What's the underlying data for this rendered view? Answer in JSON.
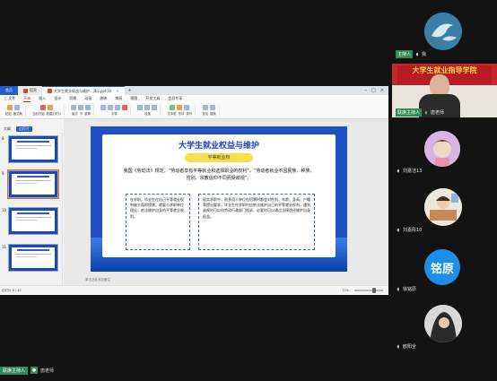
{
  "app": {
    "tabs": [
      {
        "label": "首页"
      },
      {
        "label": "稻壳"
      },
      {
        "label": "大学生就业权益与维护...演示ppt(1)"
      }
    ],
    "menu": [
      "三 文件",
      "开始",
      "插入",
      "设计",
      "切换",
      "动画",
      "放映",
      "审阅",
      "视图",
      "开发工具",
      "会员专享"
    ],
    "ribbon": [
      "粘贴",
      "格式刷",
      "当前开始",
      "新建幻灯片",
      "版式",
      "节",
      "重置",
      "字体",
      "段落",
      "文本框",
      "形状",
      "排列",
      "查找",
      "替换"
    ],
    "panel_tabs": [
      "大纲",
      "幻灯片"
    ],
    "thumb_numbers": [
      "8",
      "9",
      "10",
      "11"
    ],
    "notes_placeholder": "单击此处添加备注",
    "status_left": "幻灯片 9 / 42",
    "zoom": "71%"
  },
  "slide": {
    "title": "大学生就业权益与维护",
    "pill": "平等就业权",
    "paragraph": "我国《劳动法》规定，“劳动者享有平等就业和选择职业的权利”，“劳动者就业不因民族、种族、性别、宗教信仰不同而受歧视”。",
    "box_left": "在求职，毕业生在自己平等就业权利被大面积侵害，就要与求职单位理论，依法维护自身的平等就业权利。",
    "box_right": "现实求职中，很多用人单位在招聘时都会对性别、年龄、身高、户籍等提出要求，毕业生在求职时应依法维护自己的平等就业权利，遇到歧视时可以向劳动行政部门投诉，必要时可以通过法律途径维护自身权益。"
  },
  "host_bar": {
    "host_label": "联席主持人",
    "user": "唐老师"
  },
  "participants": [
    {
      "role": "主持人",
      "name": "我"
    },
    {
      "role": "联席主持人",
      "name": "唐老师"
    },
    {
      "name": "刘嘉洁13"
    },
    {
      "name": "刘嘉彤10"
    },
    {
      "name": "铭原",
      "avatar_text": "铭原",
      "label": "徐铭原"
    },
    {
      "name": "欧阳全"
    }
  ],
  "video_banner": "大学生就业指导学院",
  "colors": {
    "accent": "#1f5fc7",
    "host_green": "#2e8b57",
    "slide_blue": "#2050c4",
    "pill_yellow": "#f7e04a"
  }
}
